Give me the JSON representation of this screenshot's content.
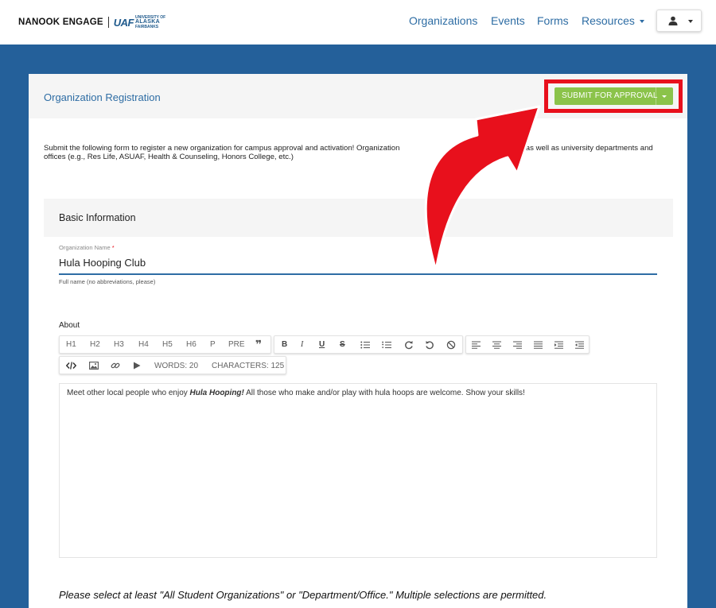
{
  "brand": {
    "name": "NANOOK ENGAGE",
    "uaf_mark": "UAF",
    "uaf_line1": "UNIVERSITY OF",
    "uaf_line2": "ALASKA",
    "uaf_line3": "FAIRBANKS"
  },
  "nav": {
    "organizations": "Organizations",
    "events": "Events",
    "forms": "Forms",
    "resources": "Resources"
  },
  "user_menu": {
    "icon": "user-icon"
  },
  "page": {
    "title": "Organization Registration",
    "submit_label": "SUBMIT FOR APPROVAL",
    "intro": "Submit the following form to register a new organization for campus approval and activation! Organization                                    organizations, as well as university departments and offices (e.g., Res Life, ASUAF, Health & Counseling, Honors College, etc.)"
  },
  "basic_info": {
    "section_title": "Basic Information",
    "org_name_label": "Organization Name",
    "org_name_required": "*",
    "org_name_value": "Hula Hooping Club",
    "org_name_help": "Full name (no abbreviations, please)"
  },
  "about": {
    "label": "About",
    "toolbar": {
      "h1": "H1",
      "h2": "H2",
      "h3": "H3",
      "h4": "H4",
      "h5": "H5",
      "h6": "H6",
      "p": "P",
      "pre": "PRE",
      "quote": "❞",
      "bold": "B",
      "italic": "I",
      "underline": "U",
      "strike": "S",
      "words": "WORDS: 20",
      "characters": "CHARACTERS: 125"
    },
    "content_before": "Meet other local people who enjoy ",
    "content_bold": "Hula Hooping!",
    "content_after": " All those who make and/or play with hula hoops are welcome. Show your skills!"
  },
  "note": "Please select at least \"All Student Organizations\" or \"Department/Office.\" Multiple selections are permitted.",
  "colors": {
    "accent_blue": "#2e6da4",
    "backdrop_blue": "#24609a",
    "submit_green": "#8bc34a",
    "highlight_red": "#e8101c"
  }
}
